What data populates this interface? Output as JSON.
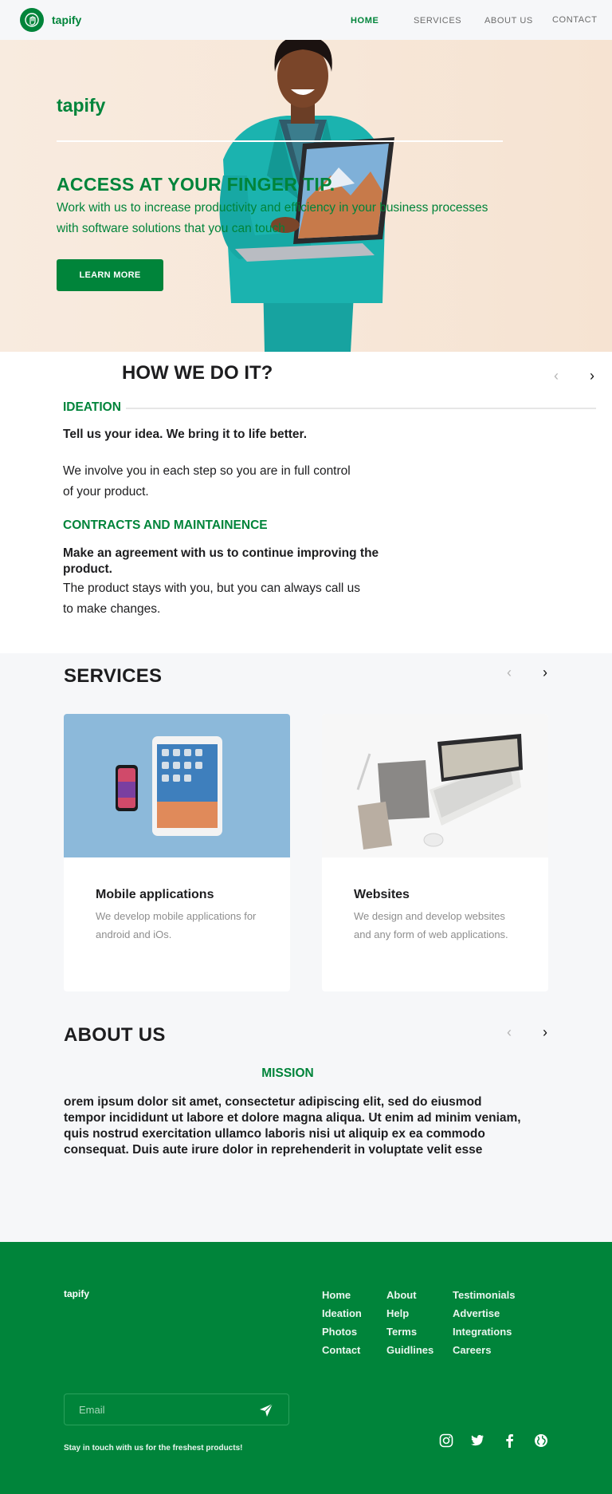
{
  "nav": {
    "logo_text": "tapify",
    "links": [
      "HOME",
      "SERVICES",
      "ABOUT US",
      "CONTACT"
    ],
    "active": "HOME"
  },
  "hero": {
    "brand": "tapify",
    "title": "ACCESS AT YOUR FINGER TIP.",
    "subtitle": "Work with us to increase productivity and efficiency in your business processes with software solutions that you can touch",
    "button": "LEARN MORE"
  },
  "how": {
    "title": "HOW WE DO IT?",
    "ideation": {
      "heading": "IDEATION",
      "bold": "Tell us your idea. We bring it to life better.",
      "text_line1": "We involve you in each step so you are in full control",
      "text_line2": "of your product."
    },
    "contracts": {
      "heading": "CONTRACTS AND MAINTAINENCE",
      "bold_line1": "Make an agreement with us to continue improving the",
      "bold_line2": "product.",
      "text_line1": "The product stays with you, but you can always call us",
      "text_line2": "to make changes."
    }
  },
  "services": {
    "title": "SERVICES",
    "cards": [
      {
        "title": "Mobile applications",
        "desc": "We develop mobile applications for android and iOs."
      },
      {
        "title": "Websites",
        "desc": "We design and develop websites and any form of web applications."
      }
    ]
  },
  "about": {
    "title": "ABOUT US",
    "mission_label": "MISSION",
    "text": "orem ipsum dolor sit amet, consectetur adipiscing elit, sed do eiusmod tempor incididunt ut labore et dolore magna aliqua. Ut enim ad minim veniam, quis nostrud exercitation ullamco laboris nisi ut aliquip ex ea commodo consequat. Duis aute irure dolor in reprehenderit in voluptate velit esse"
  },
  "footer": {
    "brand": "tapify",
    "col1": [
      "Home",
      "Ideation",
      "Photos",
      "Contact"
    ],
    "col2": [
      "About",
      "Help",
      "Terms",
      "Guidlines"
    ],
    "col3": [
      "Testimonials",
      "Advertise",
      "Integrations",
      "Careers"
    ],
    "email_placeholder": "Email",
    "tagline": "Stay in touch with us for the freshest products!",
    "social": [
      "instagram-icon",
      "twitter-icon",
      "facebook-icon",
      "globe-icon"
    ]
  },
  "colors": {
    "brand": "#00843a",
    "muted": "#8e8e8e",
    "bg_light": "#f6f7f9"
  }
}
